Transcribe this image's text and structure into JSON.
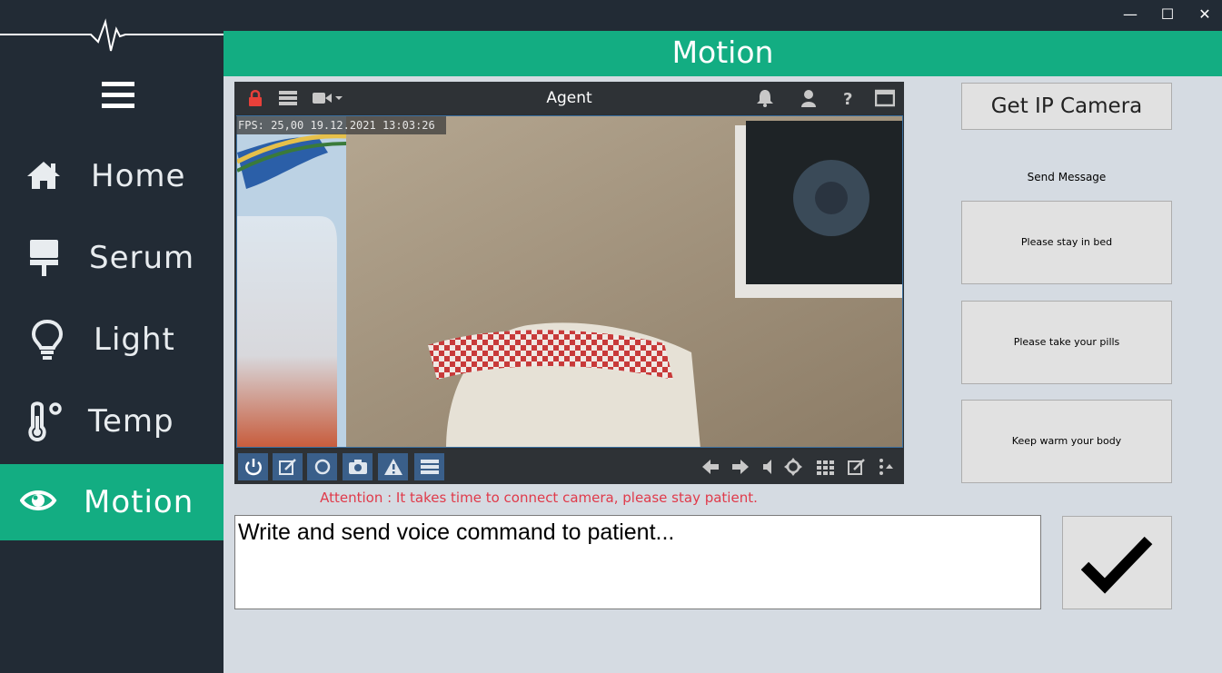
{
  "window": {
    "minimize_glyph": "—",
    "maximize_glyph": "☐",
    "close_glyph": "✕"
  },
  "sidebar": {
    "items": [
      {
        "label": "Home",
        "icon": "home-icon"
      },
      {
        "label": "Serum",
        "icon": "serum-icon"
      },
      {
        "label": "Light",
        "icon": "lightbulb-icon"
      },
      {
        "label": "Temp",
        "icon": "thermometer-icon"
      },
      {
        "label": "Motion",
        "icon": "eye-icon",
        "active": true
      }
    ]
  },
  "header": {
    "title": "Motion"
  },
  "camera": {
    "toolbar_title": "Agent",
    "overlay_text": "FPS: 25,00 19.12.2021 13:03:26"
  },
  "attention_text": "Attention : It takes time to connect camera, please stay patient.",
  "right_panel": {
    "get_ip_label": "Get IP Camera",
    "send_message_label": "Send Message",
    "messages": [
      "Please stay in bed",
      "Please take your pills",
      "Keep warm your body"
    ]
  },
  "command": {
    "placeholder": "Write and send voice command to patient..."
  },
  "colors": {
    "sidebar_bg": "#222b35",
    "accent": "#13ad82",
    "content_bg": "#d5dbe2",
    "attention": "#e03a4a"
  }
}
